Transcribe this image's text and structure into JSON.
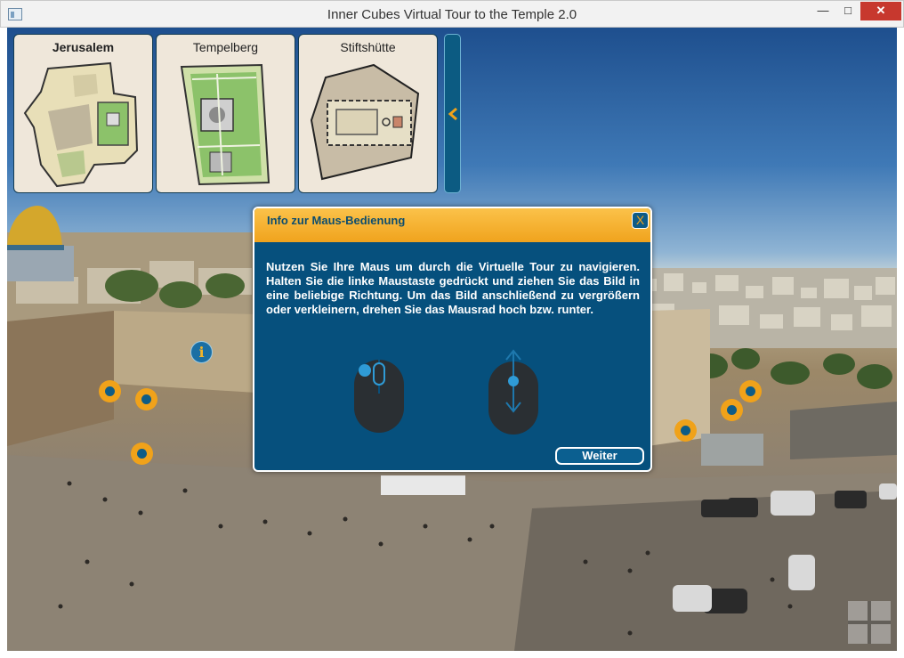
{
  "window": {
    "title": "Inner Cubes Virtual Tour to the Temple 2.0",
    "minimize_glyph": "—",
    "maximize_glyph": "□",
    "close_glyph": "✕"
  },
  "maps": [
    {
      "label": "Jerusalem",
      "active": true
    },
    {
      "label": "Tempelberg",
      "active": false
    },
    {
      "label": "Stiftshütte",
      "active": false
    }
  ],
  "collapse_tab": {
    "icon": "chevron-left-icon",
    "color": "#f0a21a"
  },
  "info_hotspot": {
    "glyph": "i"
  },
  "dialog": {
    "title": "Info zur Maus-Bedienung",
    "close_label": "X",
    "body": "Nutzen Sie Ihre Maus um durch die Virtuelle Tour zu navigieren. Halten Sie die linke Maustaste gedrückt und ziehen Sie das Bild in eine beliebige Richtung. Um das Bild anschließend zu vergrößern oder verkleinern, drehen Sie das Mausrad hoch bzw. runter.",
    "next_label": "Weiter",
    "icons": [
      "mouse-left-click-icon",
      "mouse-wheel-icon"
    ]
  },
  "colors": {
    "accent_orange": "#f0a21a",
    "dialog_blue": "#06507d",
    "sky_blue": "#2a62a2"
  }
}
